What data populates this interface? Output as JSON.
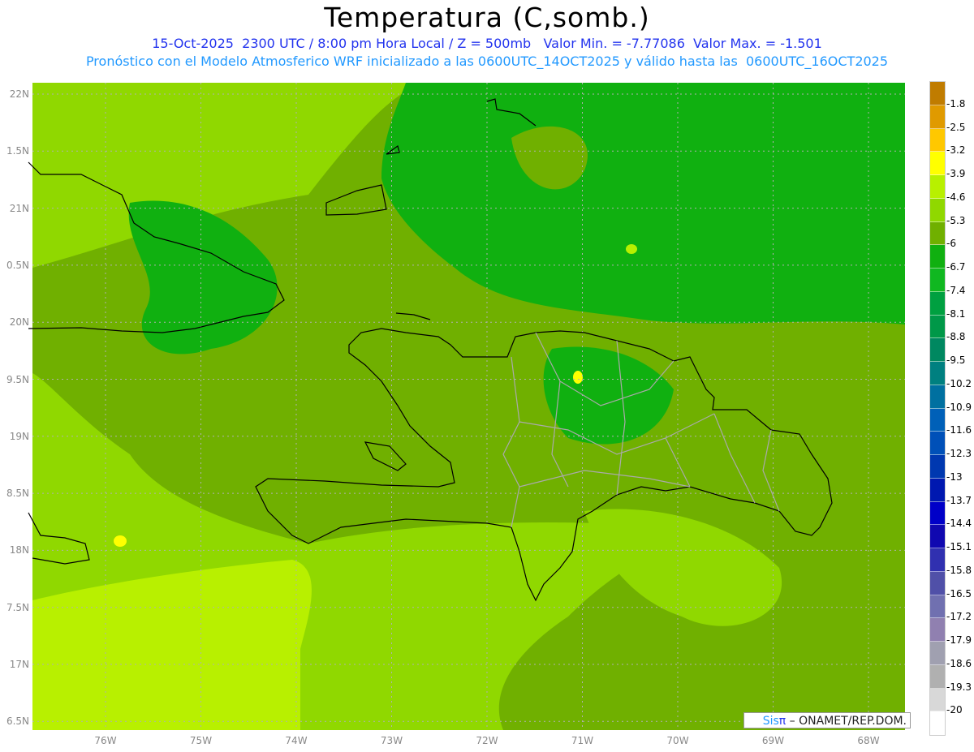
{
  "header": {
    "title": "Temperatura (C,somb.)",
    "line1": "15-Oct-2025  2300 UTC / 8:00 pm Hora Local / Z = 500mb   Valor Min. = -7.77086  Valor Max. = -1.501",
    "line2": "Pronóstico con el Modelo Atmosferico WRF inicializado a las 0600UTC_14OCT2025 y válido hasta las  0600UTC_16OCT2025"
  },
  "map": {
    "lat_labels": [
      "22N",
      "1.5N",
      "21N",
      "0.5N",
      "20N",
      "9.5N",
      "19N",
      "8.5N",
      "18N",
      "7.5N",
      "17N",
      "6.5N"
    ],
    "lon_labels": [
      "76W",
      "75W",
      "74W",
      "73W",
      "72W",
      "71W",
      "70W",
      "69W",
      "68W"
    ]
  },
  "colorbar": {
    "colors": [
      "#c07c00",
      "#e09a00",
      "#ffc800",
      "#ffff00",
      "#b8f000",
      "#90d800",
      "#70b000",
      "#10b010",
      "#10b820",
      "#00a040",
      "#009848",
      "#008860",
      "#008080",
      "#0070a0",
      "#0060b8",
      "#0050b8",
      "#0038b0",
      "#0018b0",
      "#0000c8",
      "#1008b0",
      "#3030b0",
      "#5050a8",
      "#7070b0",
      "#9080b0",
      "#a0a0b0",
      "#b0b0b0",
      "#d8d8d8",
      "#ffffff"
    ],
    "labels": [
      "-1.8",
      "-2.5",
      "-3.2",
      "-3.9",
      "-4.6",
      "-5.3",
      "-6",
      "-6.7",
      "-7.4",
      "-8.1",
      "-8.8",
      "-9.5",
      "-10.2",
      "-10.9",
      "-11.6",
      "-12.3",
      "-13",
      "-13.7",
      "-14.4",
      "-15.1",
      "-15.8",
      "-16.5",
      "-17.2",
      "-17.9",
      "-18.6",
      "-19.3",
      "-20"
    ]
  },
  "logo": {
    "sis": "Sis",
    "pi": "π",
    "text": " – ONAMET/REP.DOM."
  }
}
